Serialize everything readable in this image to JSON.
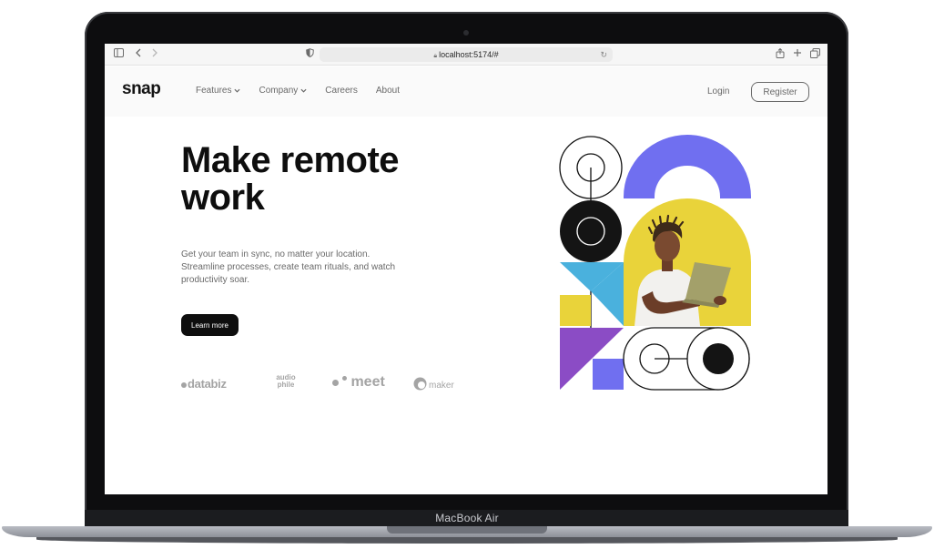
{
  "device": {
    "model_label": "MacBook Air"
  },
  "browser": {
    "url": "localhost:5174/#",
    "icons": [
      "sidebar-icon",
      "back-icon",
      "forward-icon",
      "shield-icon",
      "lock-icon",
      "reload-icon",
      "share-icon",
      "new-tab-icon",
      "tabs-icon"
    ]
  },
  "header": {
    "logo": "snap",
    "nav": [
      {
        "label": "Features",
        "has_dropdown": true
      },
      {
        "label": "Company",
        "has_dropdown": true
      },
      {
        "label": "Careers",
        "has_dropdown": false
      },
      {
        "label": "About",
        "has_dropdown": false
      }
    ],
    "login": "Login",
    "register": "Register"
  },
  "hero": {
    "headline_line1": "Make remote",
    "headline_line2": "work",
    "lead": "Get your team in sync, no matter your location. Streamline processes, create team rituals, and watch productivity soar.",
    "cta": "Learn more"
  },
  "clients": {
    "databiz": "databiz",
    "audiophile_line1": "audio",
    "audiophile_line2": "phile",
    "meet": "meet",
    "maker": "maker"
  },
  "colors": {
    "accent_purple": "#706ff0",
    "yellow": "#e9d33a",
    "blue": "#4ab1dd",
    "violet": "#8b4cc5",
    "text_dark": "#0e0e0e",
    "text_gray": "#696969"
  }
}
